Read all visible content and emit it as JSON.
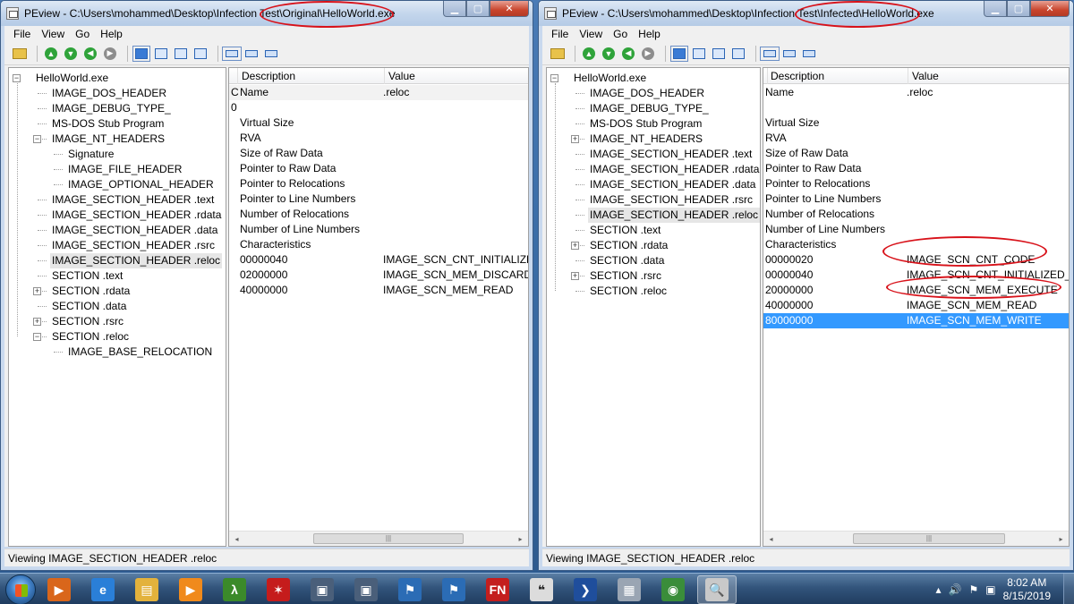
{
  "windows": {
    "left": {
      "title": "PEview - C:\\Users\\mohammed\\Desktop\\Infection Test\\Original\\HelloWorld.exe",
      "menu": [
        "File",
        "View",
        "Go",
        "Help"
      ],
      "tree": [
        {
          "label": "HelloWorld.exe",
          "depth": 0,
          "expander": "minus"
        },
        {
          "label": "IMAGE_DOS_HEADER",
          "depth": 1,
          "expander": ""
        },
        {
          "label": "IMAGE_DEBUG_TYPE_",
          "depth": 1,
          "expander": ""
        },
        {
          "label": "MS-DOS Stub Program",
          "depth": 1,
          "expander": ""
        },
        {
          "label": "IMAGE_NT_HEADERS",
          "depth": 1,
          "expander": "minus"
        },
        {
          "label": "Signature",
          "depth": 2,
          "expander": ""
        },
        {
          "label": "IMAGE_FILE_HEADER",
          "depth": 2,
          "expander": ""
        },
        {
          "label": "IMAGE_OPTIONAL_HEADER",
          "depth": 2,
          "expander": ""
        },
        {
          "label": "IMAGE_SECTION_HEADER .text",
          "depth": 1,
          "expander": ""
        },
        {
          "label": "IMAGE_SECTION_HEADER .rdata",
          "depth": 1,
          "expander": ""
        },
        {
          "label": "IMAGE_SECTION_HEADER .data",
          "depth": 1,
          "expander": ""
        },
        {
          "label": "IMAGE_SECTION_HEADER .rsrc",
          "depth": 1,
          "expander": ""
        },
        {
          "label": "IMAGE_SECTION_HEADER .reloc",
          "depth": 1,
          "expander": "",
          "selected": true
        },
        {
          "label": "SECTION .text",
          "depth": 1,
          "expander": ""
        },
        {
          "label": "SECTION .rdata",
          "depth": 1,
          "expander": "plus"
        },
        {
          "label": "SECTION .data",
          "depth": 1,
          "expander": ""
        },
        {
          "label": "SECTION .rsrc",
          "depth": 1,
          "expander": "plus"
        },
        {
          "label": "SECTION .reloc",
          "depth": 1,
          "expander": "minus"
        },
        {
          "label": "IMAGE_BASE_RELOCATION",
          "depth": 2,
          "expander": ""
        }
      ],
      "columns": {
        "c0": "",
        "c1": "Description",
        "c2": "Value"
      },
      "rows": [
        {
          "c0": "C",
          "c1": "Name",
          "c2": ".reloc",
          "style": "lightsel"
        },
        {
          "c0": "0",
          "c1": "",
          "c2": ""
        },
        {
          "c0": "",
          "c1": "Virtual Size",
          "c2": ""
        },
        {
          "c0": "",
          "c1": "RVA",
          "c2": ""
        },
        {
          "c0": "",
          "c1": "Size of Raw Data",
          "c2": ""
        },
        {
          "c0": "",
          "c1": "Pointer to Raw Data",
          "c2": ""
        },
        {
          "c0": "",
          "c1": "Pointer to Relocations",
          "c2": ""
        },
        {
          "c0": "",
          "c1": "Pointer to Line Numbers",
          "c2": ""
        },
        {
          "c0": "",
          "c1": "Number of Relocations",
          "c2": ""
        },
        {
          "c0": "",
          "c1": "Number of Line Numbers",
          "c2": ""
        },
        {
          "c0": "",
          "c1": "Characteristics",
          "c2": ""
        },
        {
          "c0": "",
          "c1": "00000040",
          "c2": "IMAGE_SCN_CNT_INITIALIZED"
        },
        {
          "c0": "",
          "c1": "02000000",
          "c2": "IMAGE_SCN_MEM_DISCARD"
        },
        {
          "c0": "",
          "c1": "40000000",
          "c2": "IMAGE_SCN_MEM_READ"
        }
      ],
      "status": "Viewing IMAGE_SECTION_HEADER .reloc"
    },
    "right": {
      "title": "PEview - C:\\Users\\mohammed\\Desktop\\Infection Test\\Infected\\HelloWorld.exe",
      "menu": [
        "File",
        "View",
        "Go",
        "Help"
      ],
      "tree": [
        {
          "label": "HelloWorld.exe",
          "depth": 0,
          "expander": "minus"
        },
        {
          "label": "IMAGE_DOS_HEADER",
          "depth": 1,
          "expander": ""
        },
        {
          "label": "IMAGE_DEBUG_TYPE_",
          "depth": 1,
          "expander": ""
        },
        {
          "label": "MS-DOS Stub Program",
          "depth": 1,
          "expander": ""
        },
        {
          "label": "IMAGE_NT_HEADERS",
          "depth": 1,
          "expander": "plus"
        },
        {
          "label": "IMAGE_SECTION_HEADER .text",
          "depth": 1,
          "expander": ""
        },
        {
          "label": "IMAGE_SECTION_HEADER .rdata",
          "depth": 1,
          "expander": ""
        },
        {
          "label": "IMAGE_SECTION_HEADER .data",
          "depth": 1,
          "expander": ""
        },
        {
          "label": "IMAGE_SECTION_HEADER .rsrc",
          "depth": 1,
          "expander": ""
        },
        {
          "label": "IMAGE_SECTION_HEADER .reloc",
          "depth": 1,
          "expander": "",
          "selected": true
        },
        {
          "label": "SECTION .text",
          "depth": 1,
          "expander": ""
        },
        {
          "label": "SECTION .rdata",
          "depth": 1,
          "expander": "plus"
        },
        {
          "label": "SECTION .data",
          "depth": 1,
          "expander": ""
        },
        {
          "label": "SECTION .rsrc",
          "depth": 1,
          "expander": "plus"
        },
        {
          "label": "SECTION .reloc",
          "depth": 1,
          "expander": ""
        }
      ],
      "columns": {
        "c0": "",
        "c1": "Description",
        "c2": "Value"
      },
      "rows": [
        {
          "c0": "",
          "c1": "Name",
          "c2": ".reloc"
        },
        {
          "c0": "",
          "c1": "",
          "c2": ""
        },
        {
          "c0": "",
          "c1": "Virtual Size",
          "c2": ""
        },
        {
          "c0": "",
          "c1": "RVA",
          "c2": ""
        },
        {
          "c0": "",
          "c1": "Size of Raw Data",
          "c2": ""
        },
        {
          "c0": "",
          "c1": "Pointer to Raw Data",
          "c2": ""
        },
        {
          "c0": "",
          "c1": "Pointer to Relocations",
          "c2": ""
        },
        {
          "c0": "",
          "c1": "Pointer to Line Numbers",
          "c2": ""
        },
        {
          "c0": "",
          "c1": "Number of Relocations",
          "c2": ""
        },
        {
          "c0": "",
          "c1": "Number of Line Numbers",
          "c2": ""
        },
        {
          "c0": "",
          "c1": "Characteristics",
          "c2": ""
        },
        {
          "c0": "",
          "c1": "00000020",
          "c2": "IMAGE_SCN_CNT_CODE"
        },
        {
          "c0": "",
          "c1": "00000040",
          "c2": "IMAGE_SCN_CNT_INITIALIZED_"
        },
        {
          "c0": "",
          "c1": "20000000",
          "c2": "IMAGE_SCN_MEM_EXECUTE"
        },
        {
          "c0": "",
          "c1": "40000000",
          "c2": "IMAGE_SCN_MEM_READ"
        },
        {
          "c0": "",
          "c1": "80000000",
          "c2": "IMAGE_SCN_MEM_WRITE",
          "style": "sel"
        }
      ],
      "status": "Viewing IMAGE_SECTION_HEADER .reloc"
    }
  },
  "scrollbar": {
    "left_arrow": "◂",
    "right_arrow": "▸",
    "thumb_grip": "|||"
  },
  "annotation_color": "#d8121a",
  "taskbar": {
    "clock_time": "8:02 AM",
    "clock_date": "8/15/2019",
    "apps": [
      {
        "name": "media-player",
        "glyph": "▶",
        "bg": "#d9661b"
      },
      {
        "name": "internet-explorer",
        "glyph": "e",
        "bg": "#2a7fd8"
      },
      {
        "name": "file-explorer",
        "glyph": "▤",
        "bg": "#e3b23c"
      },
      {
        "name": "windows-media-player",
        "glyph": "▶",
        "bg": "#f08a1c"
      },
      {
        "name": "lambda-app",
        "glyph": "λ",
        "bg": "#3b8a2a"
      },
      {
        "name": "red-splat-app",
        "glyph": "✶",
        "bg": "#c51c1c"
      },
      {
        "name": "vm-monitor-1",
        "glyph": "▣",
        "bg": "#4a5f7a"
      },
      {
        "name": "vm-monitor-2",
        "glyph": "▣",
        "bg": "#4a5f7a"
      },
      {
        "name": "windows-flag-1",
        "glyph": "⚑",
        "bg": "#2b6cb5"
      },
      {
        "name": "windows-flag-2",
        "glyph": "⚑",
        "bg": "#2b6cb5"
      },
      {
        "name": "fn-app",
        "glyph": "FN",
        "bg": "#c41e1e"
      },
      {
        "name": "quotes-app",
        "glyph": "❝",
        "bg": "#dcdcdc"
      },
      {
        "name": "powershell",
        "glyph": "❯",
        "bg": "#1f4e9c"
      },
      {
        "name": "calculator",
        "glyph": "▦",
        "bg": "#9aa5b3"
      },
      {
        "name": "chrome",
        "glyph": "◉",
        "bg": "#3a8d3a"
      },
      {
        "name": "peview-magnifier",
        "glyph": "🔍",
        "bg": "#c9c9c9",
        "active": true
      }
    ]
  }
}
